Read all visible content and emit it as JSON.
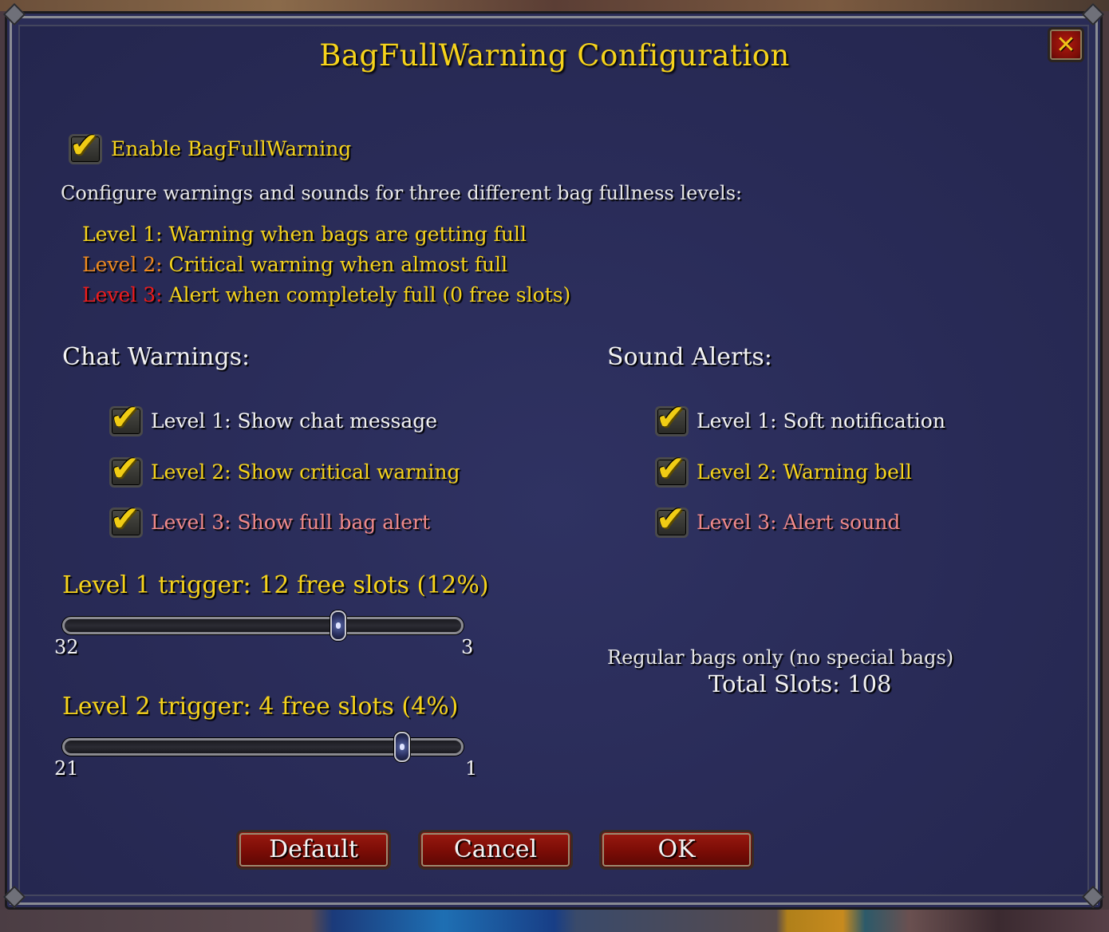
{
  "dialog": {
    "title": "BagFullWarning Configuration",
    "close_label": "✕"
  },
  "enable": {
    "label": "Enable BagFullWarning",
    "checked": true
  },
  "description": "Configure warnings and sounds for three different bag fullness levels:",
  "levels": [
    {
      "prefix": "Level 1:",
      "text": " Warning when bags are getting full",
      "color": "#f6d31b"
    },
    {
      "prefix": "Level 2:",
      "text": " Critical warning when almost full",
      "color": "#ef8a1e"
    },
    {
      "prefix": "Level 3:",
      "text": " Alert when completely full (0 free slots)",
      "color": "#ee1b1b"
    }
  ],
  "chat": {
    "heading": "Chat Warnings:",
    "items": [
      {
        "label": "Level 1: Show chat message",
        "checked": true
      },
      {
        "label": "Level 2: Show critical warning",
        "checked": true
      },
      {
        "label": "Level 3: Show full bag alert",
        "checked": true
      }
    ]
  },
  "sound": {
    "heading": "Sound Alerts:",
    "items": [
      {
        "label": "Level 1: Soft notification",
        "checked": true
      },
      {
        "label": "Level 2: Warning bell",
        "checked": true
      },
      {
        "label": "Level 3: Alert sound",
        "checked": true
      }
    ]
  },
  "slider1": {
    "label": "Level 1 trigger: 12 free slots (12%)",
    "min_label": "32",
    "max_label": "3",
    "value": 12,
    "from": 32,
    "to": 3
  },
  "slider2": {
    "label": "Level 2 trigger: 4 free slots (4%)",
    "min_label": "21",
    "max_label": "1",
    "value": 4,
    "from": 21,
    "to": 1
  },
  "info": {
    "note": "Regular bags only (no special bags)",
    "total": "Total Slots: 108"
  },
  "buttons": {
    "default_label": "Default",
    "cancel_label": "Cancel",
    "ok_label": "OK"
  },
  "colors": {
    "title": "#f6d31b",
    "level1": "#f6d31b",
    "level2": "#ef8a1e",
    "level3": "#ee1b1b",
    "level3_option": "#f08a8a",
    "panel_bg": "#2a2c56",
    "button_bg": "#8a1208"
  }
}
